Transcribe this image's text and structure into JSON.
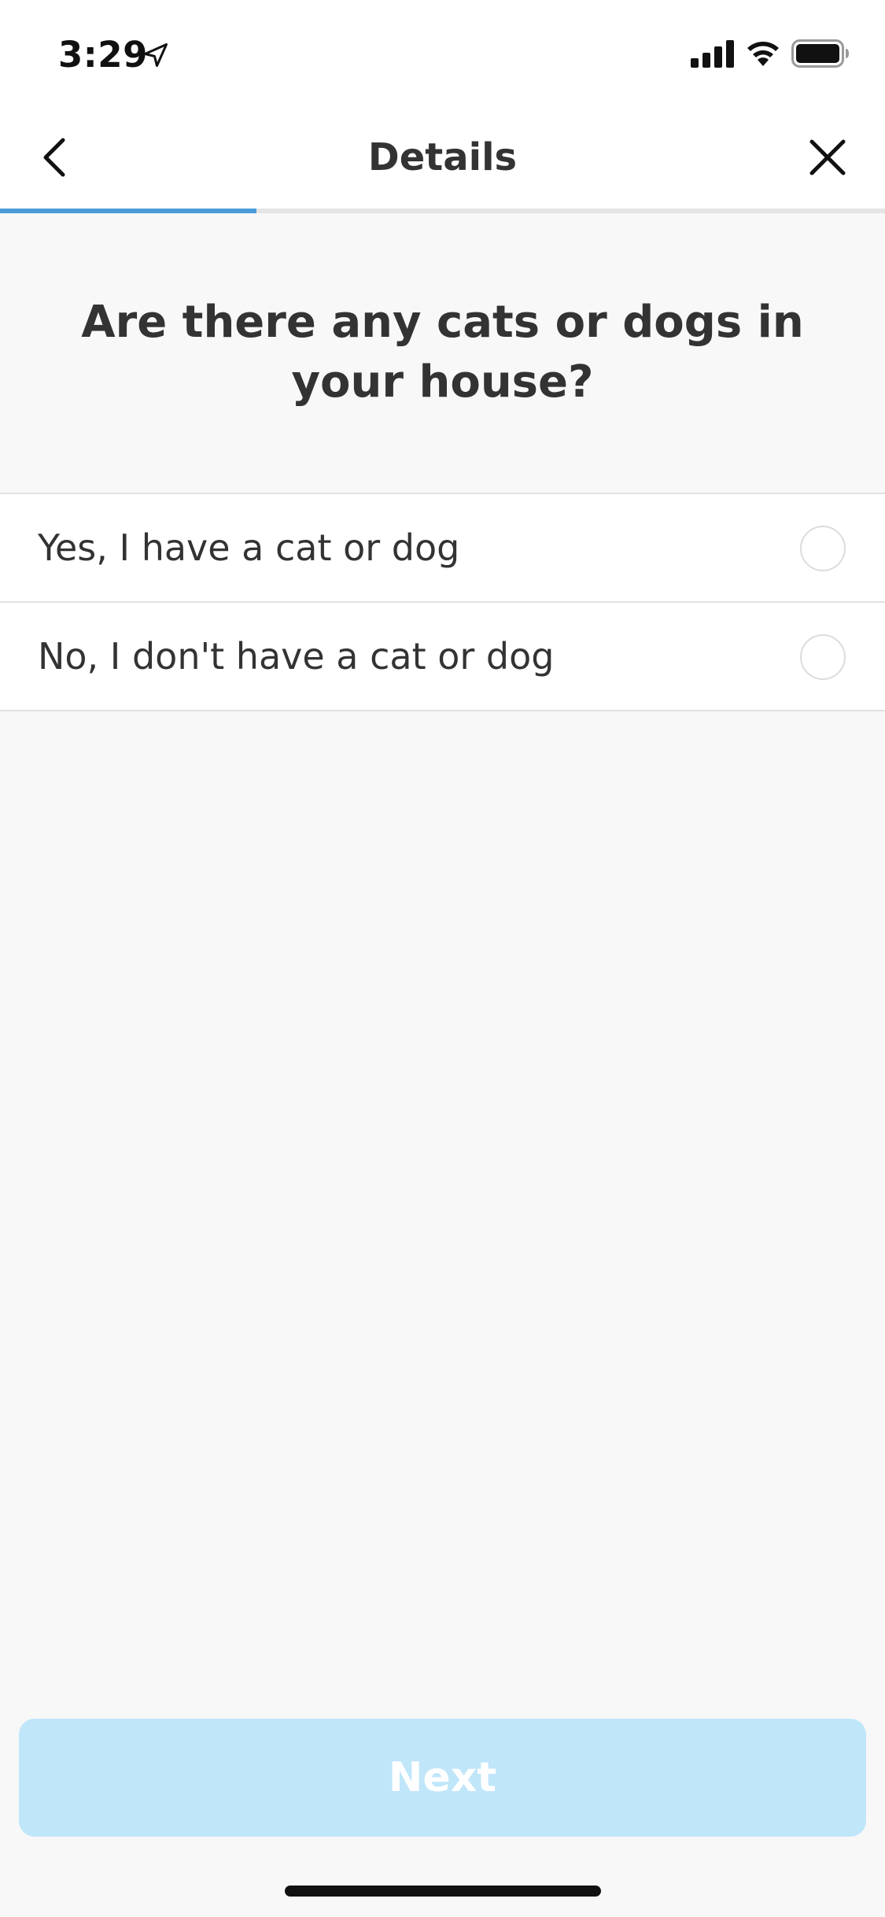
{
  "status_bar": {
    "time": "3:29"
  },
  "header": {
    "title": "Details",
    "back_icon": "chevron-left-icon",
    "close_icon": "close-icon"
  },
  "progress": {
    "fraction": 0.29,
    "color": "#4a9bd9"
  },
  "question": {
    "text": "Are there any cats or dogs in your house?"
  },
  "options": [
    {
      "label": "Yes, I have a cat or dog",
      "selected": false
    },
    {
      "label": "No, I don't have a cat or dog",
      "selected": false
    }
  ],
  "footer": {
    "next_label": "Next",
    "next_enabled": false,
    "next_color": "#c0e6fa"
  }
}
